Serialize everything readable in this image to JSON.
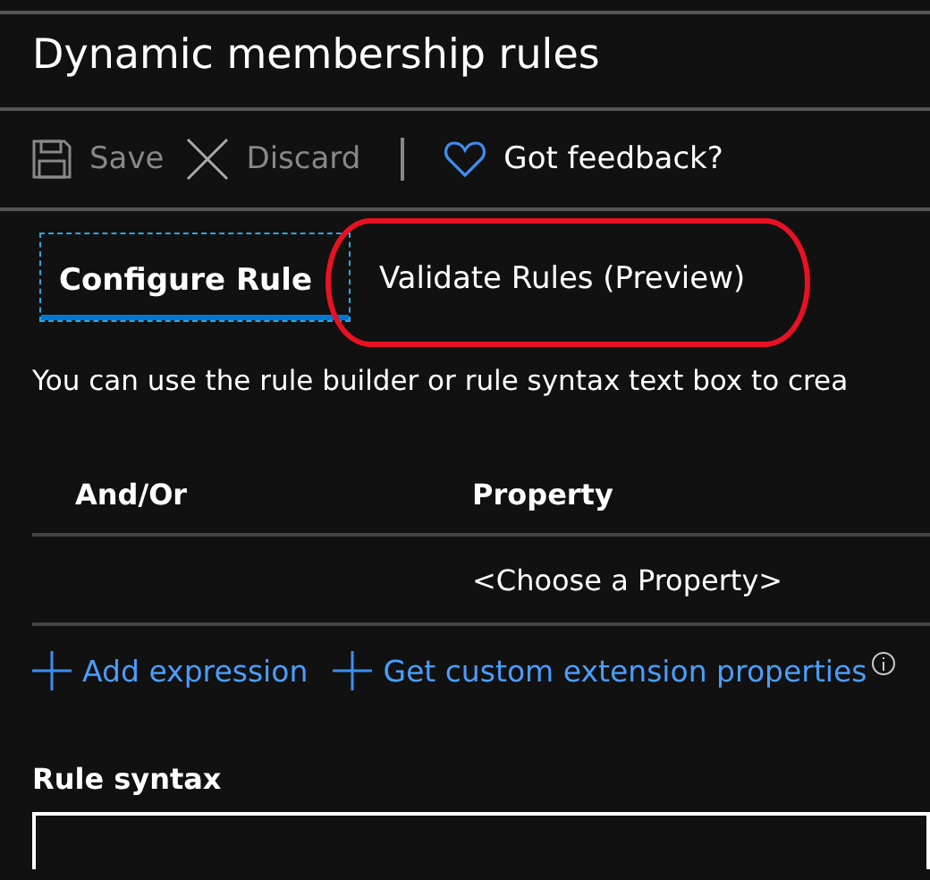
{
  "title": "Dynamic membership rules",
  "toolbar": [
    {
      "kind": "save",
      "label": "Save",
      "disabled": true
    },
    {
      "kind": "discard",
      "label": "Discard",
      "disabled": true
    },
    {
      "kind": "feedback",
      "label": "Got feedback?",
      "disabled": false
    }
  ],
  "tabs": [
    {
      "label": "Configure Rule",
      "selected": true,
      "annotated": false
    },
    {
      "label": "Validate Rules (Preview)",
      "selected": false,
      "annotated": true
    }
  ],
  "description": "You can use the rule builder or rule syntax text box to crea",
  "table": {
    "columns": [
      "And/Or",
      "Property"
    ],
    "rows": [
      {
        "property": "<Choose a Property>"
      }
    ]
  },
  "actions": [
    {
      "label": "Add expression",
      "info": false
    },
    {
      "label": "Get custom extension properties",
      "info": true
    }
  ],
  "rule_syntax": {
    "label": "Rule syntax"
  }
}
